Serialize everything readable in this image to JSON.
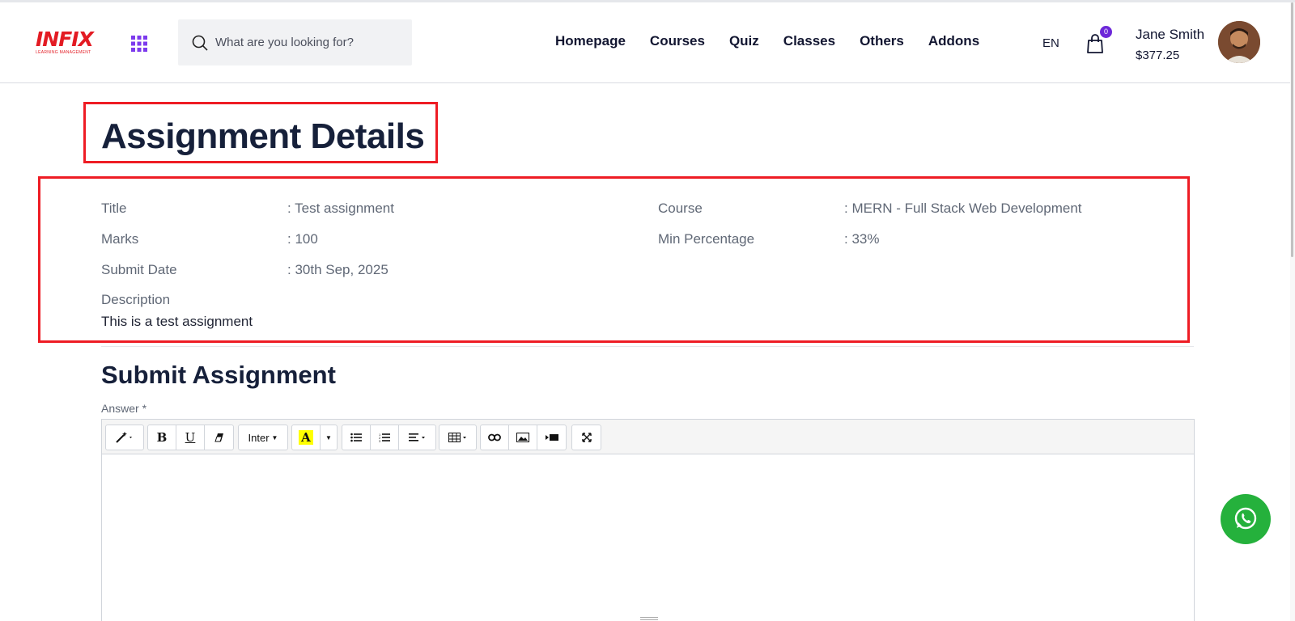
{
  "header": {
    "logo_text": "INFIX",
    "logo_subtext": "LEARNING MANAGEMENT",
    "search_placeholder": "What are you looking for?",
    "nav": [
      "Homepage",
      "Courses",
      "Quiz",
      "Classes",
      "Others",
      "Addons"
    ],
    "language": "EN",
    "cart_count": "0",
    "user_name": "Jane Smith",
    "user_balance": "$377.25"
  },
  "page": {
    "title": "Assignment Details",
    "details": {
      "title_label": "Title",
      "title_value": ": Test assignment",
      "marks_label": "Marks",
      "marks_value": ": 100",
      "submit_date_label": "Submit Date",
      "submit_date_value": ": 30th Sep, 2025",
      "course_label": "Course",
      "course_value": ": MERN - Full Stack Web Development",
      "min_percentage_label": "Min Percentage",
      "min_percentage_value": ": 33%",
      "description_label": "Description",
      "description_value": "This is a test assignment"
    },
    "submit_title": "Submit Assignment",
    "answer_label": "Answer *",
    "editor": {
      "font_select": "Inter",
      "toolbar_icons": [
        "magic-icon",
        "bold-icon",
        "underline-icon",
        "eraser-icon",
        "font-family-dropdown",
        "text-color-icon",
        "unordered-list-icon",
        "ordered-list-icon",
        "align-icon",
        "table-icon",
        "link-icon",
        "image-icon",
        "video-icon",
        "fullscreen-icon"
      ]
    }
  },
  "colors": {
    "brand_red": "#e31b23",
    "highlight_red": "#ee1c24",
    "nav_dark": "#121631",
    "accent_purple": "#6d28d9",
    "whatsapp_green": "#25b13c"
  }
}
